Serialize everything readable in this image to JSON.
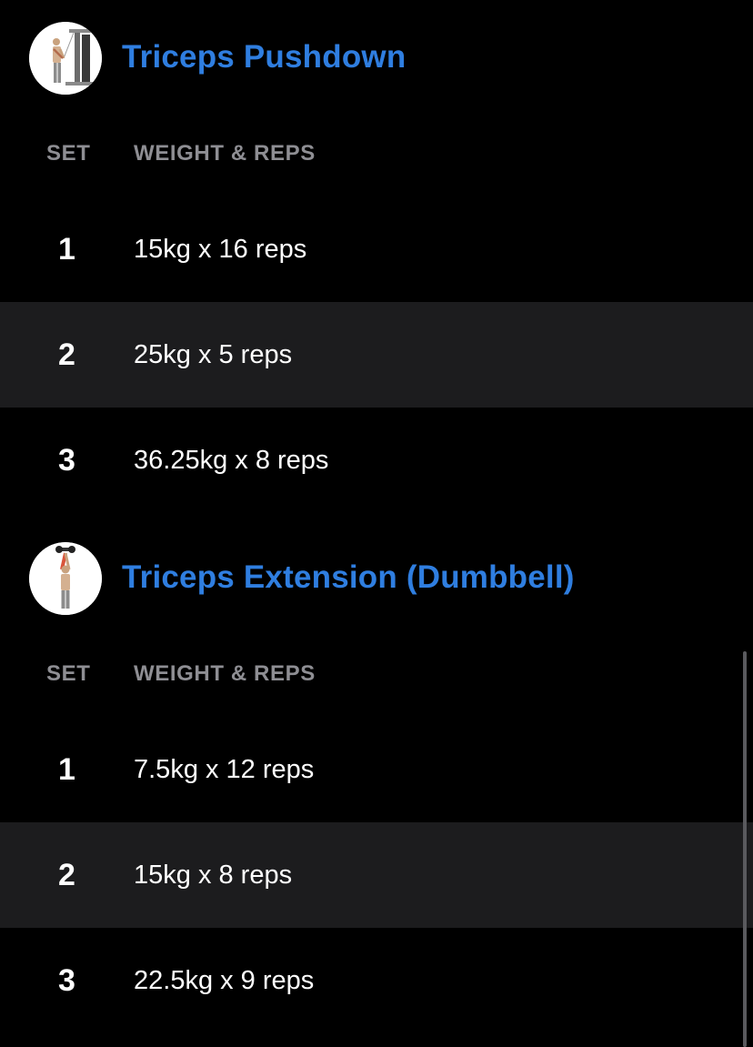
{
  "colors": {
    "background": "#000000",
    "title_accent": "#2f7ee0",
    "header_text": "#8e8e93",
    "row_shade": "#1c1c1e",
    "value_text": "#ffffff"
  },
  "columns": {
    "set": "SET",
    "weight_reps": "WEIGHT & REPS"
  },
  "exercises": [
    {
      "name": "Triceps Pushdown",
      "icon": "cable-machine-person-icon",
      "sets": [
        {
          "number": "1",
          "weight_reps": "15kg x 16 reps"
        },
        {
          "number": "2",
          "weight_reps": "25kg x 5 reps"
        },
        {
          "number": "3",
          "weight_reps": "36.25kg x 8 reps"
        }
      ]
    },
    {
      "name": "Triceps Extension (Dumbbell)",
      "icon": "dumbbell-overhead-person-icon",
      "sets": [
        {
          "number": "1",
          "weight_reps": "7.5kg x 12 reps"
        },
        {
          "number": "2",
          "weight_reps": "15kg x 8 reps"
        },
        {
          "number": "3",
          "weight_reps": "22.5kg x 9 reps"
        }
      ]
    }
  ]
}
